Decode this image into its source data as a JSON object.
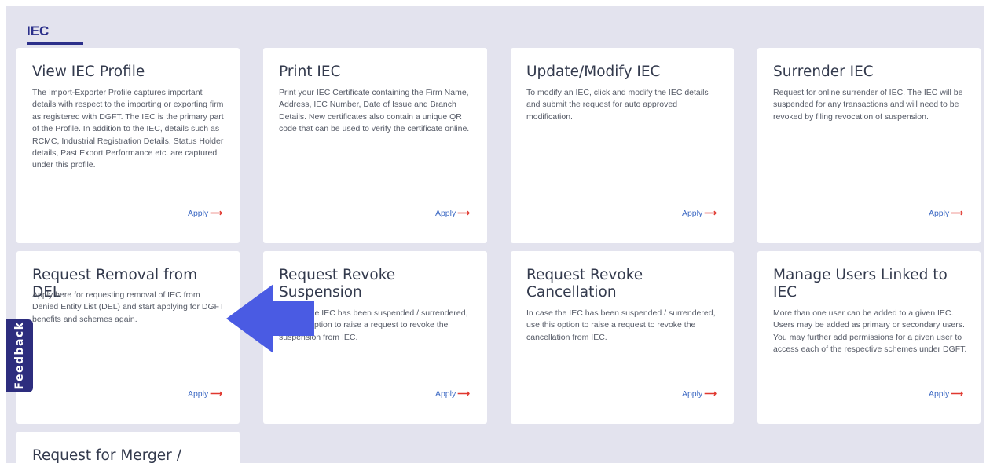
{
  "section": {
    "title": "IEC"
  },
  "cards": [
    {
      "title": "View IEC Profile",
      "description": "The Import-Exporter Profile captures important details with respect to the importing or exporting firm as registered with DGFT. The IEC is the primary part of the Profile. In addition to the IEC, details such as RCMC, Industrial Registration Details, Status Holder details, Past Export Performance etc. are captured under this profile.",
      "apply": "Apply"
    },
    {
      "title": "Print IEC",
      "description": "Print your IEC Certificate containing the Firm Name, Address, IEC Number, Date of Issue and Branch Details. New certificates also contain a unique QR code that can be used to verify the certificate online.",
      "apply": "Apply"
    },
    {
      "title": "Update/Modify IEC",
      "description": "To modify an IEC, click and modify the IEC details and submit the request for auto approved modification.",
      "apply": "Apply"
    },
    {
      "title": "Surrender IEC",
      "description": "Request for online surrender of IEC. The IEC will be suspended for any transactions and will need to be revoked by filing revocation of suspension.",
      "apply": "Apply"
    },
    {
      "title": "Request Removal from DEL",
      "description": "Apply here for requesting removal of IEC from Denied Entity List (DEL) and start applying for DGFT benefits and schemes again.",
      "apply": "Apply"
    },
    {
      "title": "Request Revoke Suspension",
      "description": "In case the IEC has been suspended / surrendered, use this option to raise a request to revoke the suspension from IEC.",
      "apply": "Apply"
    },
    {
      "title": "Request Revoke Cancellation",
      "description": "In case the IEC has been suspended / surrendered, use this option to raise a request to revoke the cancellation from IEC.",
      "apply": "Apply"
    },
    {
      "title": "Manage Users Linked to IEC",
      "description": "More than one user can be added to a given IEC. Users may be added as primary or secondary users. You may further add permissions for a given user to access each of the respective schemes under DGFT.",
      "apply": "Apply"
    },
    {
      "title": "Request for Merger /",
      "description": "",
      "apply": ""
    }
  ],
  "feedback": {
    "label": "Feedback"
  },
  "colors": {
    "background": "#e3e3ee",
    "accent": "#2b2f8a",
    "link": "#3f6bc4",
    "arrow_overlay": "#4a5be3"
  }
}
